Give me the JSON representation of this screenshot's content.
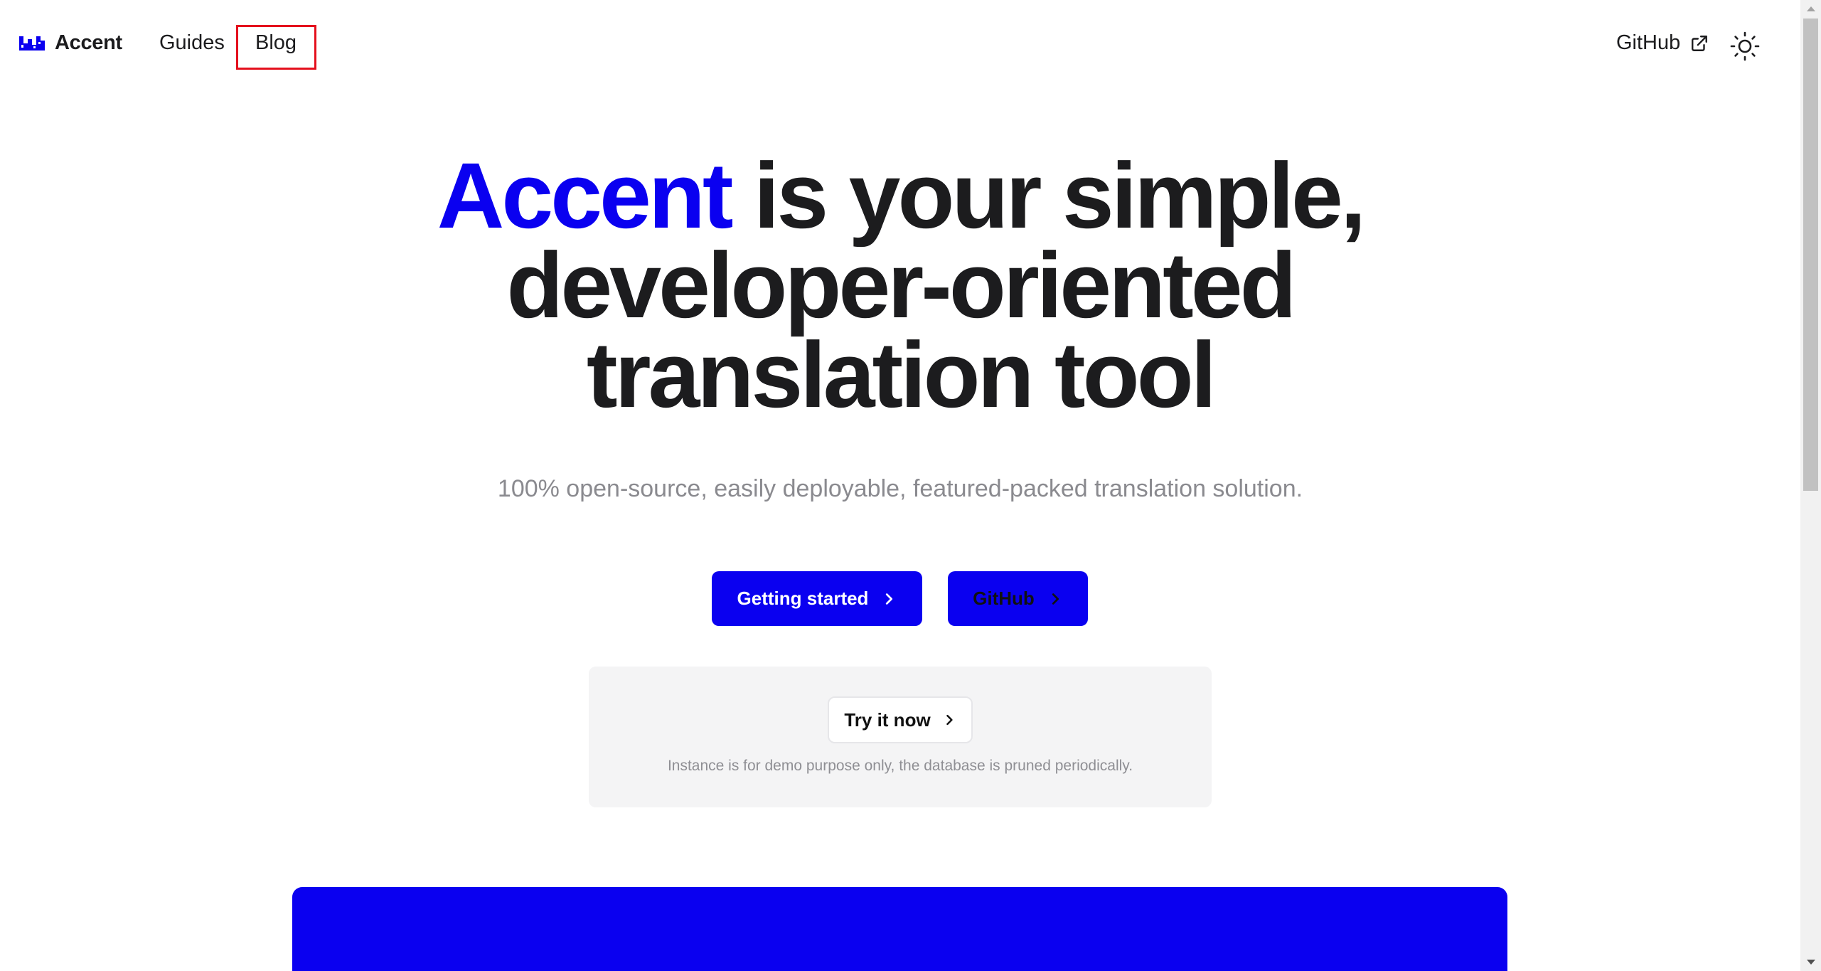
{
  "nav": {
    "brand_name": "Accent",
    "links": [
      {
        "label": "Guides"
      },
      {
        "label": "Blog"
      }
    ],
    "github_label": "GitHub",
    "icons": [
      "accent-logo-icon",
      "external-link-icon",
      "sun-icon"
    ]
  },
  "hero": {
    "title_accent": "Accent",
    "title_rest_line1": " is your simple,",
    "title_line2": "developer-oriented",
    "title_line3": "translation tool",
    "subtitle": "100% open-source, easily deployable, featured-packed translation solution."
  },
  "buttons": {
    "getting_started": "Getting started",
    "github": "GitHub"
  },
  "demo": {
    "try_label": "Try it now",
    "note": "Instance is for demo purpose only, the database is pruned periodically."
  },
  "colors": {
    "accent": "#0a00f0",
    "text": "#1c1c1e",
    "muted": "#8a8a8f",
    "highlight": "#e4101d"
  }
}
